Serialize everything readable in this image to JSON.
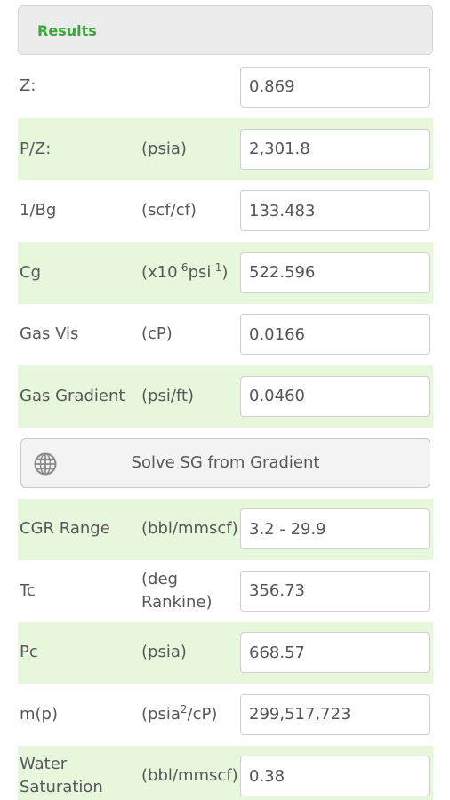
{
  "results": {
    "title": "Results",
    "rows_top": [
      {
        "label": "Z:",
        "unit": "",
        "value": "0.869",
        "style": "light"
      },
      {
        "label": "P/Z:",
        "unit": "(psia)",
        "value": "2,301.8",
        "style": "alt"
      },
      {
        "label": "1/Bg",
        "unit": "(scf/cf)",
        "value": "133.483",
        "style": "light"
      },
      {
        "label": "Cg",
        "unit_parts": [
          "(x10",
          "-6",
          "psi",
          "-1",
          ")"
        ],
        "value": "522.596",
        "style": "alt"
      },
      {
        "label": "Gas Vis",
        "unit": "(cP)",
        "value": "0.0166",
        "style": "light"
      },
      {
        "label": "Gas Gradient",
        "unit": "(psi/ft)",
        "value": "0.0460",
        "style": "alt"
      }
    ],
    "solve_button": {
      "label": "Solve SG from Gradient",
      "icon": "globe-icon"
    },
    "rows_bottom": [
      {
        "label": "CGR Range",
        "unit": "(bbl/mmscf)",
        "value": "3.2 - 29.9",
        "style": "alt"
      },
      {
        "label": "Tc",
        "unit_lines": [
          "(deg",
          "Rankine)"
        ],
        "value": "356.73",
        "style": "light"
      },
      {
        "label": "Pc",
        "unit": "(psia)",
        "value": "668.57",
        "style": "alt"
      },
      {
        "label": "m(p)",
        "unit_parts": [
          "(psia",
          "2",
          "/cP)"
        ],
        "value": "299,517,723",
        "style": "light"
      },
      {
        "label_lines": [
          "Water",
          "Saturation"
        ],
        "unit": "(bbl/mmscf)",
        "value": "0.38",
        "style": "alt"
      }
    ]
  },
  "colors": {
    "accent": "#3aa53a",
    "row_alt": "#e6f7dc"
  }
}
